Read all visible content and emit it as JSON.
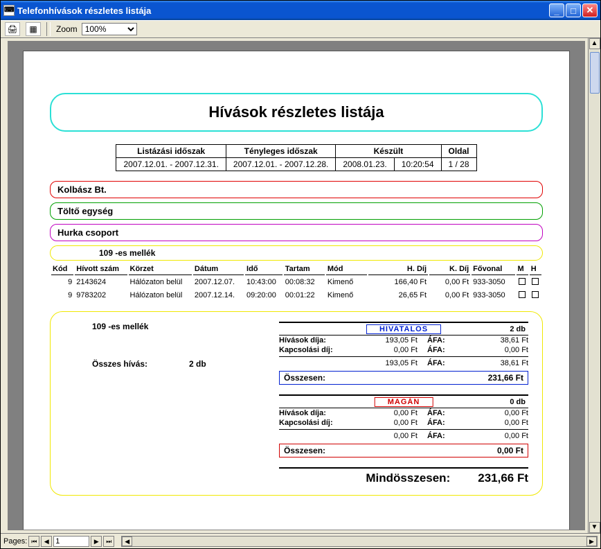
{
  "window": {
    "title": "Telefonhívások részletes listája"
  },
  "toolbar": {
    "zoom_label": "Zoom",
    "zoom_value": "100%"
  },
  "report": {
    "title": "Hívások részletes listája",
    "info_headers": {
      "listing_period": "Listázási időszak",
      "actual_period": "Tényleges időszak",
      "created": "Készült",
      "page": "Oldal"
    },
    "info_values": {
      "listing_period": "2007.12.01. - 2007.12.31.",
      "actual_period": "2007.12.01. - 2007.12.28.",
      "created_date": "2008.01.23.",
      "created_time": "10:20:54",
      "page": "1 / 28"
    },
    "company": "Kolbász Bt.",
    "unit": "Töltő egység",
    "group": "Hurka csoport",
    "extension_label": "109  -es mellék",
    "columns": {
      "kod": "Kód",
      "hivott": "Hívott szám",
      "korzet": "Körzet",
      "datum": "Dátum",
      "ido": "Idő",
      "tartam": "Tartam",
      "mod": "Mód",
      "hdij": "H. Díj",
      "kdij": "K. Díj",
      "fovonal": "Fővonal",
      "m": "M",
      "h": "H"
    },
    "rows": [
      {
        "kod": "9",
        "hivott": "2143624",
        "korzet": "Hálózaton belül",
        "datum": "2007.12.07.",
        "ido": "10:43:00",
        "tartam": "00:08:32",
        "mod": "Kimenő",
        "hdij": "166,40 Ft",
        "kdij": "0,00 Ft",
        "fovonal": "933-3050"
      },
      {
        "kod": "9",
        "hivott": "9783202",
        "korzet": "Hálózaton belül",
        "datum": "2007.12.14.",
        "ido": "09:20:00",
        "tartam": "00:01:22",
        "mod": "Kimenő",
        "hdij": "26,65 Ft",
        "kdij": "0,00 Ft",
        "fovonal": "933-3050"
      }
    ],
    "summary": {
      "ext_label": "109  -es mellék",
      "all_calls_label": "Összes hívás:",
      "all_calls_value": "2 db",
      "sections": {
        "hivatalos": {
          "tag": "HIVATALOS",
          "count": "2 db",
          "rows": {
            "call_fee_label": "Hívások díja:",
            "call_fee_value": "193,05 Ft",
            "vat_label": "ÁFA:",
            "call_fee_vat": "38,61 Ft",
            "conn_fee_label": "Kapcsolási díj:",
            "conn_fee_value": "0,00 Ft",
            "conn_fee_vat": "0,00 Ft",
            "sum_value": "193,05 Ft",
            "sum_vat": "38,61 Ft"
          },
          "total_label": "Összesen:",
          "total_value": "231,66 Ft"
        },
        "magan": {
          "tag": "MAGÁN",
          "count": "0 db",
          "rows": {
            "call_fee_label": "Hívások díja:",
            "call_fee_value": "0,00 Ft",
            "vat_label": "ÁFA:",
            "call_fee_vat": "0,00 Ft",
            "conn_fee_label": "Kapcsolási díj:",
            "conn_fee_value": "0,00 Ft",
            "conn_fee_vat": "0,00 Ft",
            "sum_value": "0,00 Ft",
            "sum_vat": "0,00 Ft"
          },
          "total_label": "Összesen:",
          "total_value": "0,00 Ft"
        }
      },
      "grand_label": "Mindösszesen:",
      "grand_value": "231,66 Ft"
    }
  },
  "footer": {
    "pages_label": "Pages:",
    "page_value": "1"
  }
}
